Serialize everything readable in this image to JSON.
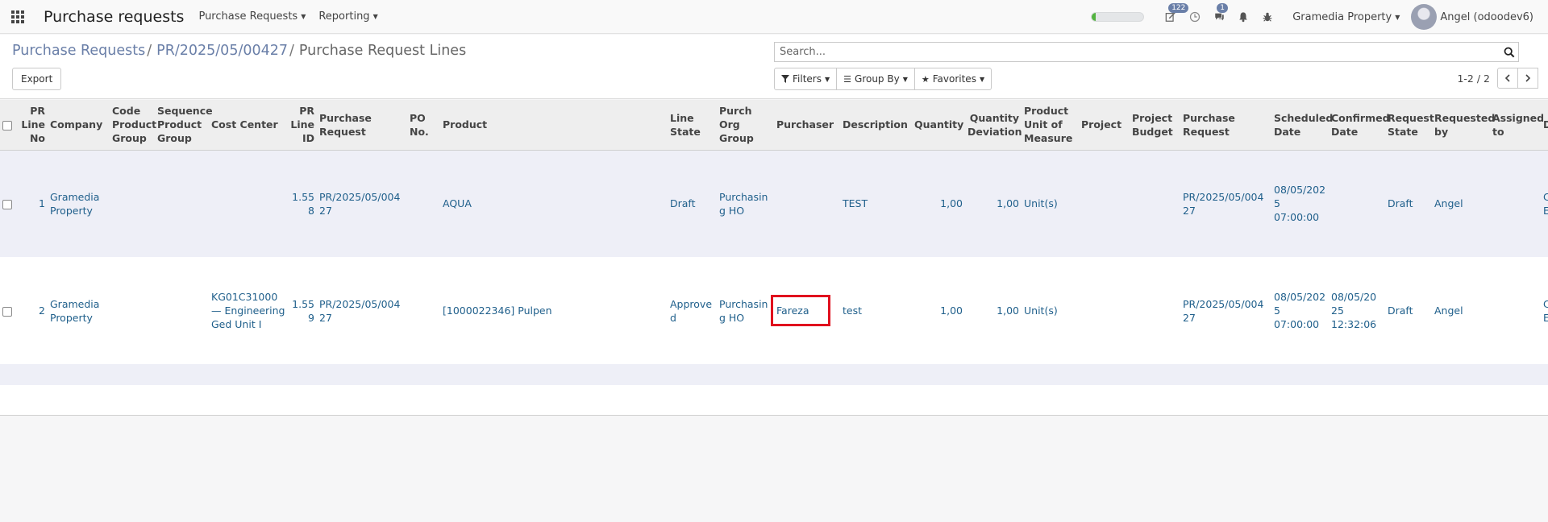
{
  "navbar": {
    "app_title": "Purchase requests",
    "menus": [
      "Purchase Requests",
      "Reporting"
    ],
    "progress": 0.08,
    "activity_badge": "122",
    "messages_badge": "1",
    "company": "Gramedia Property",
    "user": "Angel (odoodev6)"
  },
  "breadcrumb": {
    "items": [
      "Purchase Requests",
      "PR/2025/05/00427"
    ],
    "separator": "/",
    "active": "Purchase Request Lines"
  },
  "toolbar": {
    "export_label": "Export"
  },
  "search": {
    "placeholder": "Search..."
  },
  "filters": {
    "filters_label": "Filters",
    "groupby_label": "Group By",
    "favorites_label": "Favorites"
  },
  "pager": {
    "value": "1-2 / 2"
  },
  "table": {
    "headers": [
      "PR Line No",
      "Company",
      "Code Product Group",
      "Sequence Product Group",
      "Cost Center",
      "PR Line ID",
      "Purchase Request",
      "PO No.",
      "Product",
      "Line State",
      "Purch Org Group",
      "Purchaser",
      "Description",
      "Quantity",
      "Quantity Deviation",
      "Product Unit of Measure",
      "Project",
      "Project Budget",
      "Purchase Request",
      "Scheduled Date",
      "Confirmed Date",
      "Request State",
      "Requested by",
      "Assigned to",
      "D T"
    ],
    "rows": [
      {
        "line_no": "1",
        "company": "Gramedia Property",
        "code_group": "",
        "seq_group": "",
        "cost_center": "",
        "line_id": "1.558",
        "purchase_request": "PR/2025/05/00427",
        "po_no": "",
        "product": "AQUA",
        "line_state": "Draft",
        "org_group": "Purchasing HO",
        "purchaser": "",
        "description": "TEST",
        "quantity": "1,00",
        "qty_deviation": "1,00",
        "uom": "Unit(s)",
        "project": "",
        "project_budget": "",
        "purchase_request_2": "PR/2025/05/00427",
        "scheduled_date": "08/05/2025 07:00:00",
        "confirmed_date": "",
        "request_state": "Draft",
        "requested_by": "Angel",
        "assigned_to": "",
        "extra": "C F ( C E F F"
      },
      {
        "line_no": "2",
        "company": "Gramedia Property",
        "code_group": "",
        "seq_group": "",
        "cost_center": "KG01C31000 — Engineering Ged Unit I",
        "line_id": "1.559",
        "purchase_request": "PR/2025/05/00427",
        "po_no": "",
        "product": "[1000022346] Pulpen",
        "line_state": "Approved",
        "org_group": "Purchasing HO",
        "purchaser": "Fareza",
        "description": "test",
        "quantity": "1,00",
        "qty_deviation": "1,00",
        "uom": "Unit(s)",
        "project": "",
        "project_budget": "",
        "purchase_request_2": "PR/2025/05/00427",
        "scheduled_date": "08/05/2025 07:00:00",
        "confirmed_date": "08/05/2025 12:32:06",
        "request_state": "Draft",
        "requested_by": "Angel",
        "assigned_to": "",
        "extra": "C F ( C E F F"
      }
    ]
  },
  "colors": {
    "accent": "#6a7fa8",
    "link": "#1f5f8b",
    "highlight": "#e0101e",
    "progress": "#52b33f"
  }
}
